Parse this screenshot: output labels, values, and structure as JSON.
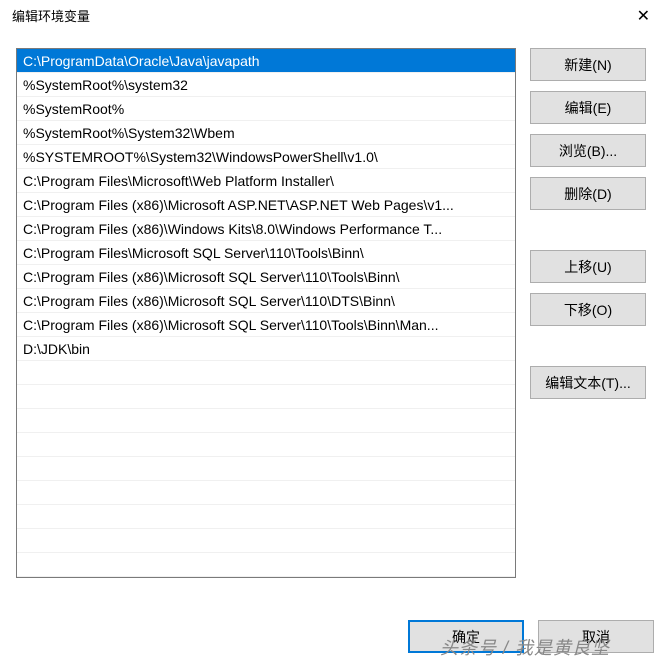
{
  "window": {
    "title": "编辑环境变量",
    "close": "✕"
  },
  "list": {
    "items": [
      "C:\\ProgramData\\Oracle\\Java\\javapath",
      "%SystemRoot%\\system32",
      "%SystemRoot%",
      "%SystemRoot%\\System32\\Wbem",
      "%SYSTEMROOT%\\System32\\WindowsPowerShell\\v1.0\\",
      "C:\\Program Files\\Microsoft\\Web Platform Installer\\",
      "C:\\Program Files (x86)\\Microsoft ASP.NET\\ASP.NET Web Pages\\v1...",
      "C:\\Program Files (x86)\\Windows Kits\\8.0\\Windows Performance T...",
      "C:\\Program Files\\Microsoft SQL Server\\110\\Tools\\Binn\\",
      "C:\\Program Files (x86)\\Microsoft SQL Server\\110\\Tools\\Binn\\",
      "C:\\Program Files (x86)\\Microsoft SQL Server\\110\\DTS\\Binn\\",
      "C:\\Program Files (x86)\\Microsoft SQL Server\\110\\Tools\\Binn\\Man...",
      "D:\\JDK\\bin"
    ],
    "selected_index": 0
  },
  "buttons": {
    "new": "新建(N)",
    "edit": "编辑(E)",
    "browse": "浏览(B)...",
    "delete": "删除(D)",
    "move_up": "上移(U)",
    "move_down": "下移(O)",
    "edit_text": "编辑文本(T)...",
    "ok": "确定",
    "cancel": "取消"
  },
  "watermark": "头条号 / 我是黄良坚"
}
